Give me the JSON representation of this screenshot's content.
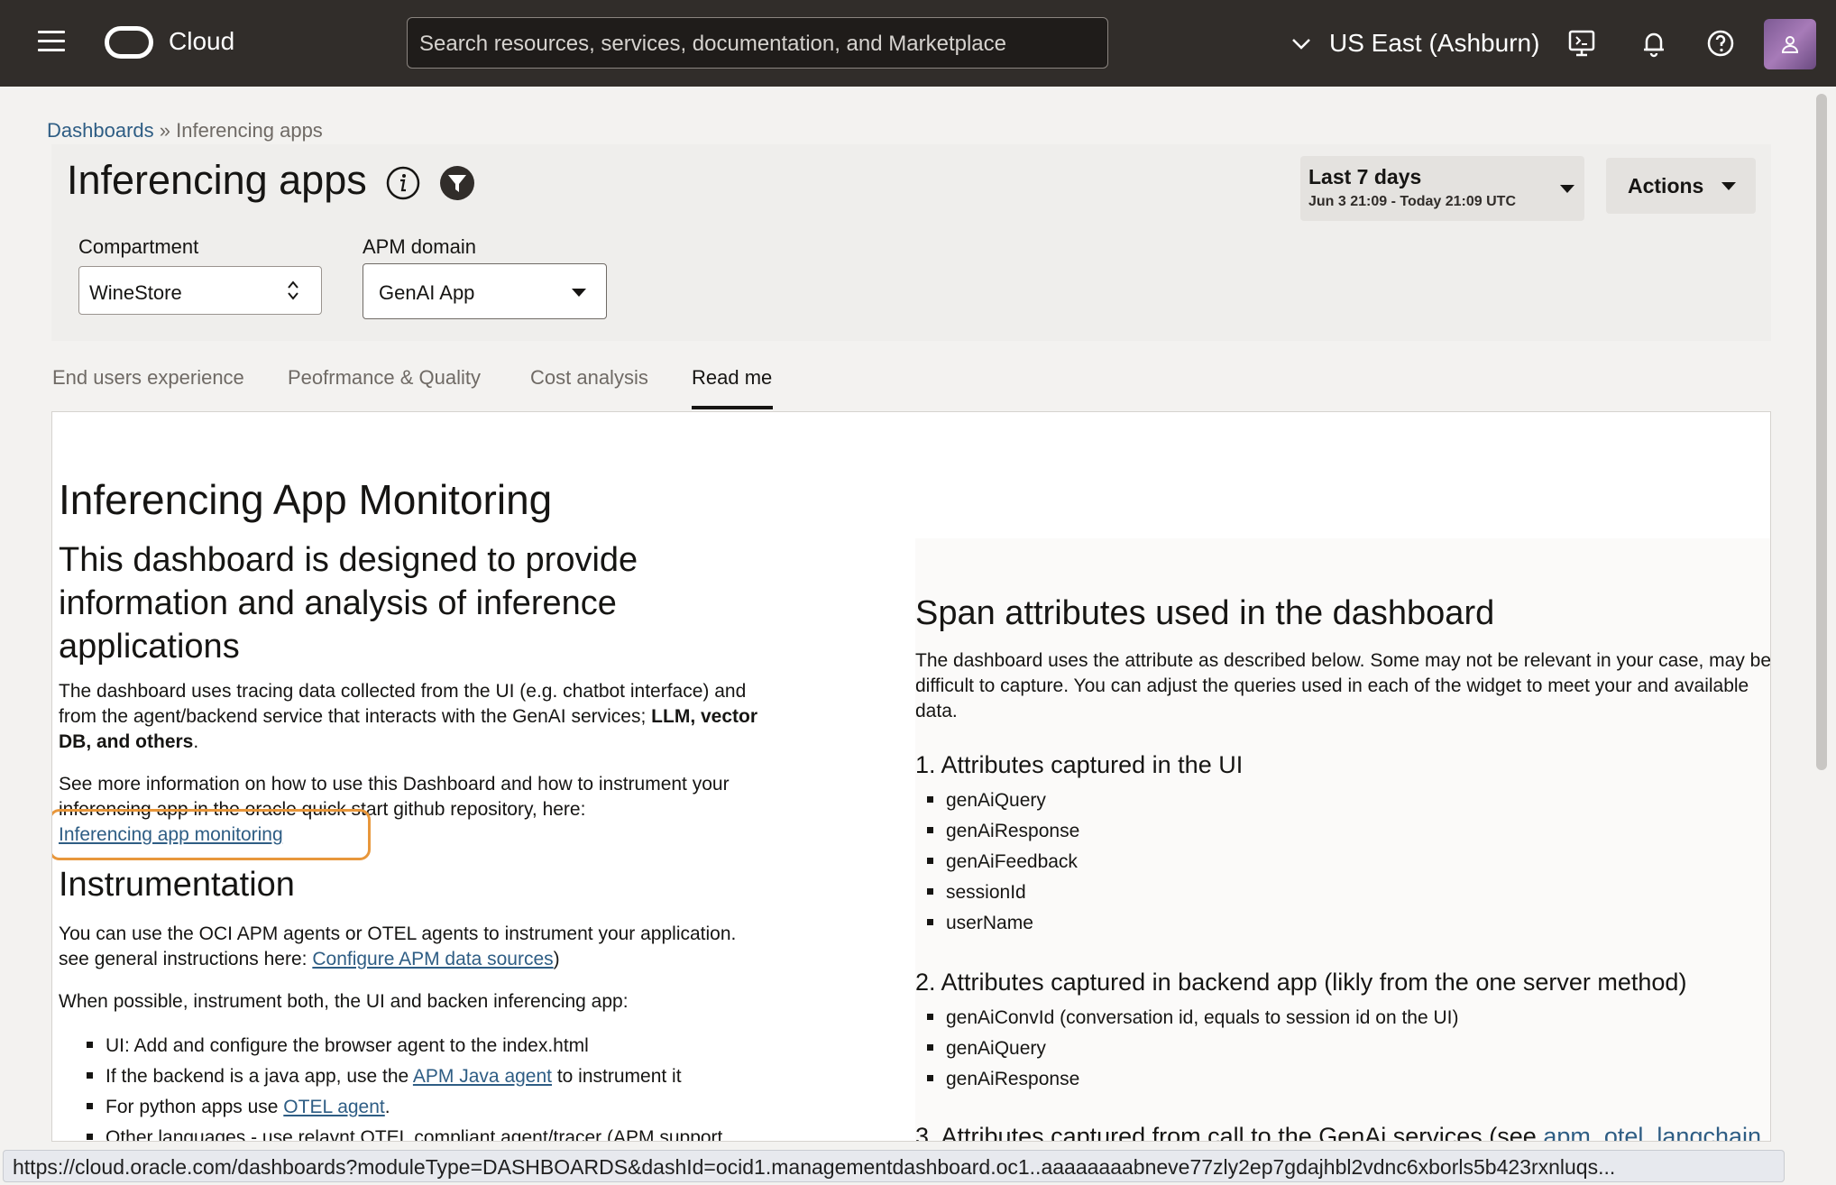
{
  "topbar": {
    "brand": "Cloud",
    "search_placeholder": "Search resources, services, documentation, and Marketplace",
    "region": "US East (Ashburn)"
  },
  "breadcrumb": {
    "root": "Dashboards",
    "separator": "»",
    "current": "Inferencing apps"
  },
  "header": {
    "title": "Inferencing apps",
    "time_range": {
      "label": "Last 7 days",
      "detail": "Jun 3 21:09 - Today 21:09 UTC"
    },
    "actions_label": "Actions"
  },
  "filters": {
    "compartment": {
      "label": "Compartment",
      "value": "WineStore"
    },
    "apm_domain": {
      "label": "APM domain",
      "value": "GenAI App"
    }
  },
  "tabs": [
    {
      "label": "End users experience"
    },
    {
      "label": "Peofrmance & Quality"
    },
    {
      "label": "Cost analysis"
    },
    {
      "label": "Read me"
    }
  ],
  "readme": {
    "title": "Inferencing App Monitoring",
    "subtitle": "This dashboard is designed to provide information and analysis of inference applications",
    "intro_1": "The dashboard uses tracing data collected from the UI (e.g. chatbot interface) and from the agent/backend service that interacts with the GenAI services;",
    "intro_bold": "LLM, vector DB, and others",
    "intro_end": ".",
    "more_info": "See more information on how to use this Dashboard and how to instrument your inferencing app in the oracle quick start github repository, here:",
    "monitoring_link": "Inferencing app monitoring",
    "instrumentation_title": "Instrumentation",
    "instr_text": "You can use the OCI APM agents or OTEL agents to instrument your application. see general instructions here:",
    "instr_link": "Configure APM data sources",
    "instr_end": ")",
    "instr_both": "When possible, instrument both, the UI and backen inferencing app:",
    "bullets": {
      "ui": "UI: Add and configure the browser agent to the index.html",
      "java_pre": "If the backend is a java app, use the ",
      "java_link": "APM Java agent",
      "java_post": " to instrument it",
      "py_pre": "For python apps use ",
      "py_link": "OTEL agent",
      "py_post": ".",
      "other": "Other languages - use relaynt OTEL compliant agent/tracer (APM support"
    }
  },
  "span_attributes": {
    "title": "Span attributes used in the dashboard",
    "desc": "The dashboard uses the attribute as described below. Some may not be relevant in your case, may be difficult to capture. You can adjust the queries used in each of the widget to meet your and available data.",
    "ui_title": "1. Attributes captured in the UI",
    "ui_items": [
      "genAiQuery",
      "genAiResponse",
      "genAiFeedback",
      "sessionId",
      "userName"
    ],
    "backend_title": "2. Attributes captured in backend app (likly from the one server method)",
    "backend_items": [
      "genAiConvId (conversation id, equals to session id on the UI)",
      "genAiQuery",
      "genAiResponse"
    ],
    "genai_title_partial": "3. Attributes captured from call to the GenAi services (see ",
    "genai_link_partial": "apm_otel_langchain"
  },
  "status_url": "https://cloud.oracle.com/dashboards?moduleType=DASHBOARDS&dashId=ocid1.managementdashboard.oc1..aaaaaaaabneve77zly2ep7gdajhbl2vdnc6xborls5b423rxnluqs..."
}
